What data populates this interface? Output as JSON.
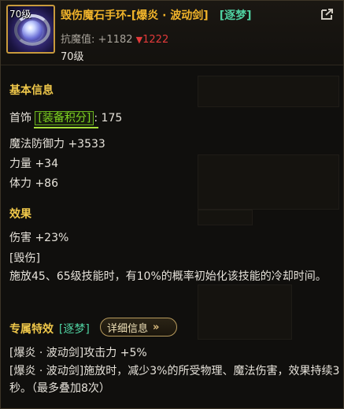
{
  "item": {
    "level_badge": "70级",
    "name": "毁伤魔石手环-[爆炎 · 波动剑]",
    "tag": "[逐梦]",
    "resist_label": "抗魔值:",
    "resist_gain": "+1182",
    "resist_loss": "1222",
    "level": "70级"
  },
  "basic": {
    "title": "基本信息",
    "slot_label": "首饰",
    "score_label": "[装备积分]",
    "score_value": ": 175",
    "stats": [
      "魔法防御力 +3533",
      "力量 +34",
      "体力 +86"
    ]
  },
  "effect": {
    "title": "效果",
    "damage": "伤害 +23%",
    "tag": "[毁伤]",
    "desc": "施放45、65级技能时，有10%的概率初始化该技能的冷却时间。"
  },
  "special": {
    "title": "专属特效",
    "tag": "[逐梦]",
    "detail_button": "详细信息",
    "line1": "[爆炎 · 波动剑]攻击力 +5%",
    "line2": "[爆炎 · 波动剑]施放时，减少3%的所受物理、魔法伤害，效果持续3秒。（最多叠加8次）"
  },
  "colors": {
    "title_gold": "#f0b32a",
    "section_gold": "#f0c84a",
    "teal": "#4fd0a0",
    "green": "#7ed321",
    "red": "#e23a3a"
  }
}
